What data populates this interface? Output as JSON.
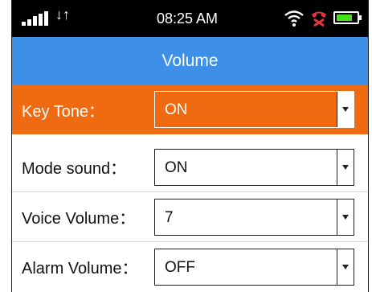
{
  "status_bar": {
    "time": "08:25 AM",
    "sync_glyph": "↓↑",
    "icons": [
      "signal-icon",
      "sync-icon",
      "wifi-icon",
      "missed-call-icon",
      "battery-icon"
    ],
    "battery_level": 0.8,
    "colors": {
      "background": "#000000",
      "battery_fill": "#48e01a",
      "call_icon": "#e8323a"
    }
  },
  "header": {
    "title": "Volume",
    "background": "#3d8fe8"
  },
  "settings": [
    {
      "label": "Key Tone：",
      "value": "ON",
      "selected": true
    },
    {
      "label": "Mode sound：",
      "value": "ON",
      "selected": false
    },
    {
      "label": "Voice Volume：",
      "value": "7",
      "selected": false
    },
    {
      "label": "Alarm Volume：",
      "value": "OFF",
      "selected": false
    }
  ],
  "colors": {
    "selected_row": "#ef6a10"
  }
}
